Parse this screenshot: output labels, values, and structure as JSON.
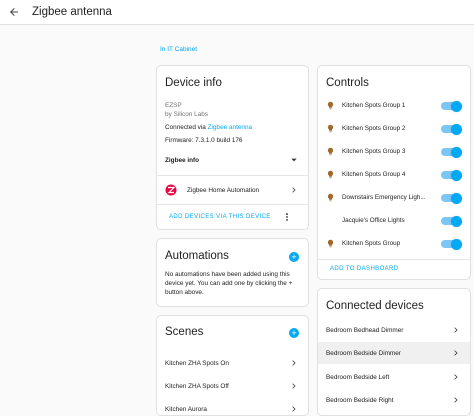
{
  "header": {
    "title": "Zigbee antenna",
    "back_icon": "arrow-left-icon"
  },
  "breadcrumb": {
    "area": "In IT Cabinet"
  },
  "device_info": {
    "title": "Device info",
    "model": "EZSP",
    "manufacturer": "by Silicon Labs",
    "connected_prefix": "Connected via ",
    "connected_link": "Zigbee antenna",
    "firmware": "Firmware: 7.3.1.0 build 176",
    "zigbee_info_label": "Zigbee info",
    "integration_label": "Zigbee Home Automation",
    "add_devices_label": "ADD DEVICES VIA THIS DEVICE"
  },
  "automations": {
    "title": "Automations",
    "empty_text": "No automations have been added using this device yet. You can add one by clicking the + button above."
  },
  "scenes": {
    "title": "Scenes",
    "items": [
      "Kitchen ZHA Spots On",
      "Kitchen ZHA Spots Off",
      "Kitchen Aurora"
    ]
  },
  "controls": {
    "title": "Controls",
    "items": [
      {
        "label": "Kitchen Spots Group 1",
        "on": true,
        "icon": "bulb-icon"
      },
      {
        "label": "Kitchen Spots Group 2",
        "on": true,
        "icon": "bulb-icon"
      },
      {
        "label": "Kitchen Spots Group 3",
        "on": true,
        "icon": "bulb-icon"
      },
      {
        "label": "Kitchen Spots Group 4",
        "on": true,
        "icon": "bulb-icon"
      },
      {
        "label": "Downstairs Emergency Ligh...",
        "on": true,
        "icon": "bulb-icon"
      },
      {
        "label": "Jacquie's Office Lights",
        "on": true,
        "icon": "none"
      },
      {
        "label": "Kitchen Spots Group",
        "on": true,
        "icon": "bulb-icon"
      }
    ],
    "add_to_dashboard_label": "ADD TO DASHBOARD"
  },
  "connected_devices": {
    "title": "Connected devices",
    "items": [
      "Bedroom Bedhead Dimmer",
      "Bedroom Bedside Dimmer",
      "Bedroom Bedside Left",
      "Bedroom Bedside Right"
    ]
  },
  "colors": {
    "accent": "#03a9f4",
    "bulb": "#a0692c",
    "text": "#212121",
    "muted": "#727272",
    "highlight": "#f0f0f0"
  }
}
